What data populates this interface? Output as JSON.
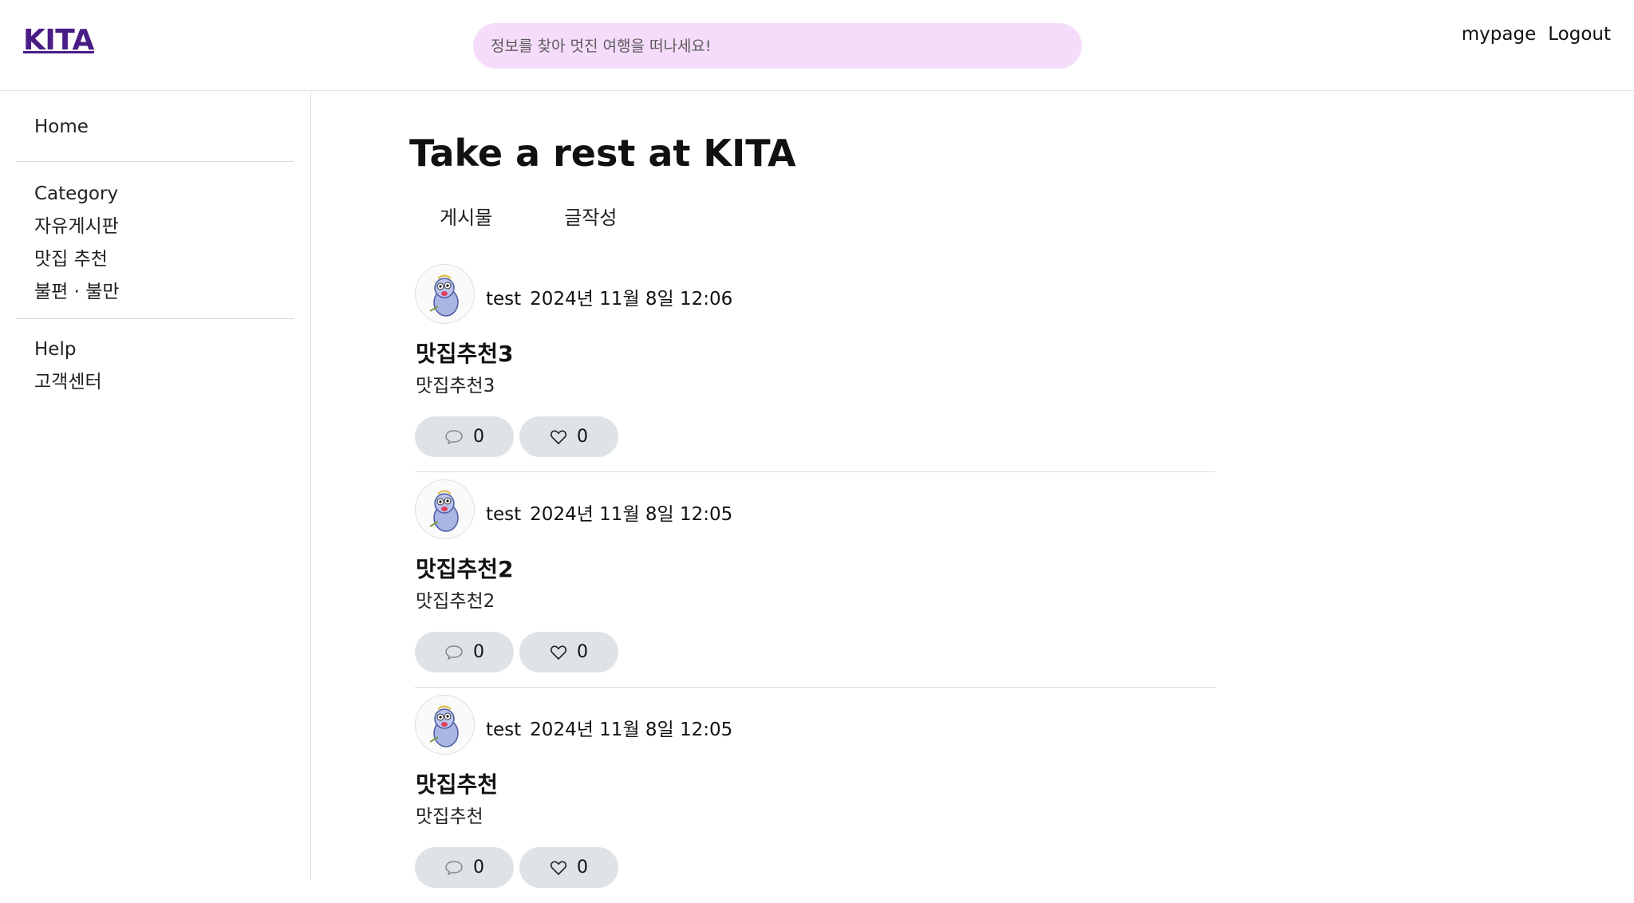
{
  "header": {
    "logo": "KITA",
    "search_placeholder": "정보를 찾아 멋진 여행을 떠나세요!",
    "nav": {
      "mypage": "mypage",
      "logout": "Logout"
    }
  },
  "sidebar": {
    "home": "Home",
    "category": {
      "heading": "Category",
      "items": [
        "자유게시판",
        "맛집 추천",
        "불편 · 불만"
      ]
    },
    "help": {
      "heading": "Help",
      "items": [
        "고객센터"
      ]
    }
  },
  "main": {
    "title": "Take a rest at KITA",
    "tabs": [
      "게시물",
      "글작성"
    ],
    "posts": [
      {
        "author": "test",
        "date": "2024년 11월 8일 12:06",
        "title": "맛집추천3",
        "body": "맛집추천3",
        "comments": "0",
        "likes": "0"
      },
      {
        "author": "test",
        "date": "2024년 11월 8일 12:05",
        "title": "맛집추천2",
        "body": "맛집추천2",
        "comments": "0",
        "likes": "0"
      },
      {
        "author": "test",
        "date": "2024년 11월 8일 12:05",
        "title": "맛집추천",
        "body": "맛집추천",
        "comments": "0",
        "likes": "0"
      }
    ]
  },
  "colors": {
    "logo": "#4a1d86",
    "search_bg": "#f6dcfb",
    "pill_bg": "#dde3e6"
  },
  "icons": {
    "comment": "speech-bubble-icon",
    "like": "heart-icon",
    "avatar": "user-avatar"
  }
}
